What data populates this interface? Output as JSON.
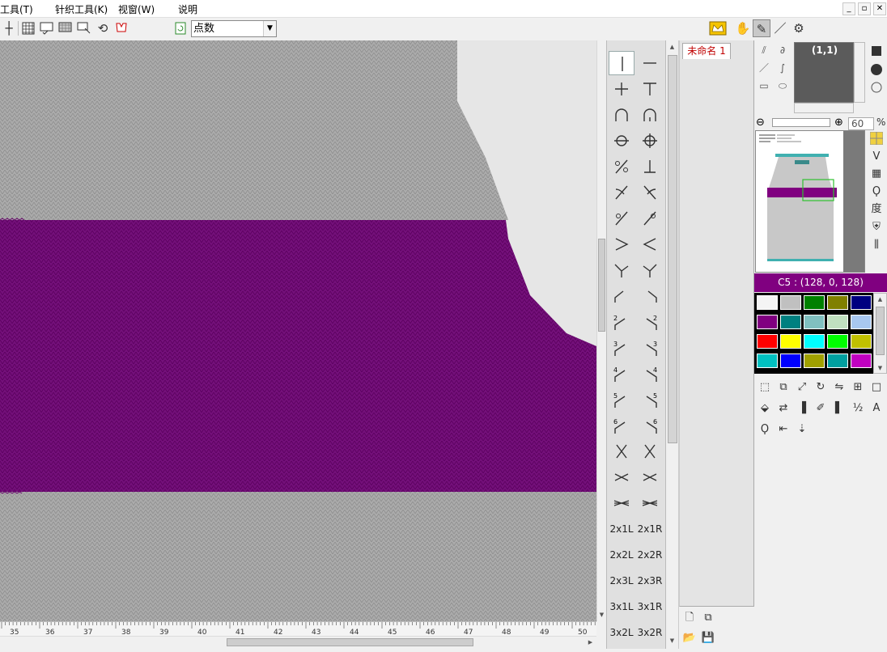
{
  "menubar": {
    "items": [
      "工具(T)",
      "针织工具(K)",
      "视窗(W)",
      "说明"
    ],
    "window_controls": [
      "_",
      "▫",
      "✕"
    ]
  },
  "toolbar": {
    "mode_select": "点数"
  },
  "canvas": {
    "ruler_labels": [
      "35",
      "36",
      "37",
      "38",
      "39",
      "40",
      "41",
      "42",
      "43",
      "44",
      "45",
      "46",
      "47",
      "48",
      "49",
      "50"
    ],
    "colors": {
      "gray": "#a8a8a8",
      "purple": "#6f0a6f",
      "background": "#e6e6e6"
    }
  },
  "stitch_palette": {
    "text_cells": [
      "2x1L",
      "2x1R",
      "2x2L",
      "2x2R",
      "2x3L",
      "2x3R",
      "3x1L",
      "3x1R",
      "3x2L",
      "3x2R"
    ],
    "numbered": [
      "2",
      "2",
      "3",
      "3",
      "4",
      "4",
      "5",
      "5",
      "6",
      "6"
    ]
  },
  "file_panel": {
    "tab_label": "未命名 1"
  },
  "draw_panel": {
    "coord": "(1,1)",
    "zoom_value": "60",
    "zoom_unit": "%",
    "degree_label": "度"
  },
  "color_panel": {
    "current_color_label": "C5 : (128, 0, 128)",
    "swatches": [
      [
        "#f4f4f4",
        "#c0c0c0",
        "#008000",
        "#808000",
        "#000080"
      ],
      [
        "#800080",
        "#008080",
        "#80c0c0",
        "#c0e0c0",
        "#a8c8f0"
      ],
      [
        "#ff0000",
        "#ffff00",
        "#00ffff",
        "#00ff00",
        "#c0c000"
      ],
      [
        "#00c0c0",
        "#0000ff",
        "#a0a000",
        "#00a0a0",
        "#c000c0"
      ]
    ]
  }
}
